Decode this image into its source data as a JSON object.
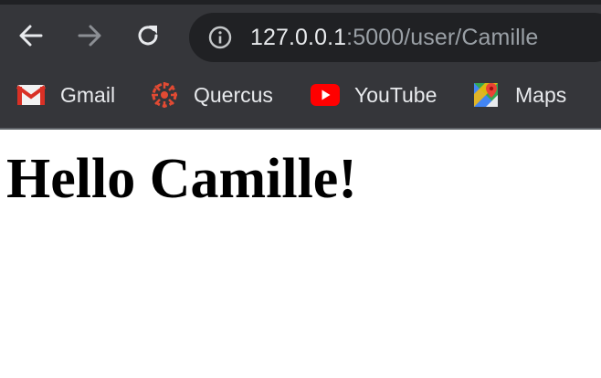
{
  "browser": {
    "url_host": "127.0.0.1",
    "url_path": ":5000/user/Camille"
  },
  "toolbar": {
    "icons": [
      "back-arrow-icon",
      "forward-arrow-icon",
      "reload-icon",
      "info-icon"
    ]
  },
  "bookmarks": [
    {
      "label": "Gmail",
      "icon": "gmail-icon"
    },
    {
      "label": "Quercus",
      "icon": "quercus-icon"
    },
    {
      "label": "YouTube",
      "icon": "youtube-icon"
    },
    {
      "label": "Maps",
      "icon": "maps-icon"
    }
  ],
  "page": {
    "heading": "Hello Camille!"
  },
  "colors": {
    "chrome_background": "#35363a",
    "omnibox_background": "#202124",
    "url_host": "#e8eaed",
    "url_path": "#9aa0a6",
    "page_background": "#ffffff",
    "heading": "#000000"
  }
}
